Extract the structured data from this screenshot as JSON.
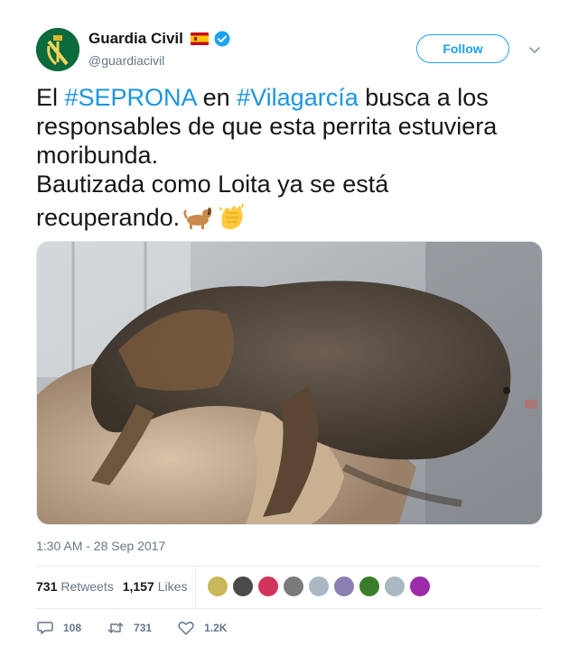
{
  "author": {
    "name": "Guardia Civil",
    "handle": "@guardiacivil",
    "verified": true,
    "flag": "spain-flag-icon",
    "avatar_color": "#0b6b3a"
  },
  "follow_label": "Follow",
  "text": {
    "line1_pre": "El ",
    "line1_tag1": "#SEPRONA",
    "line1_mid": " en ",
    "line1_tag2": "#Vilagarcía",
    "line1_post": " busca a los",
    "line2": "responsables de que esta perrita estuviera",
    "line3": "moribunda.",
    "line4": "Bautizada como Loita ya  se está",
    "line5": "recuperando.",
    "emojis": [
      "dog-emoji",
      "clapping-hands-emoji"
    ]
  },
  "media": {
    "type": "photo",
    "subject": "dog-on-towel-photo"
  },
  "timestamp": "1:30 AM - 28 Sep 2017",
  "stats": {
    "retweets_count": "731",
    "retweets_label": "Retweets",
    "likes_count": "1,157",
    "likes_label": "Likes"
  },
  "likers": [
    {
      "color": "#c8b85a"
    },
    {
      "color": "#4a4a4a"
    },
    {
      "color": "#d2335a"
    },
    {
      "color": "#7a7a7a"
    },
    {
      "color": "#aab8c2"
    },
    {
      "color": "#8a7fb0"
    },
    {
      "color": "#3a7d2c"
    },
    {
      "color": "#aab8c2"
    },
    {
      "color": "#9b2ba8"
    }
  ],
  "actions": {
    "replies": "108",
    "retweets": "731",
    "likes": "1.2K"
  },
  "colors": {
    "link": "#1b95e0",
    "accent": "#1da1f2",
    "muted": "#657786"
  }
}
